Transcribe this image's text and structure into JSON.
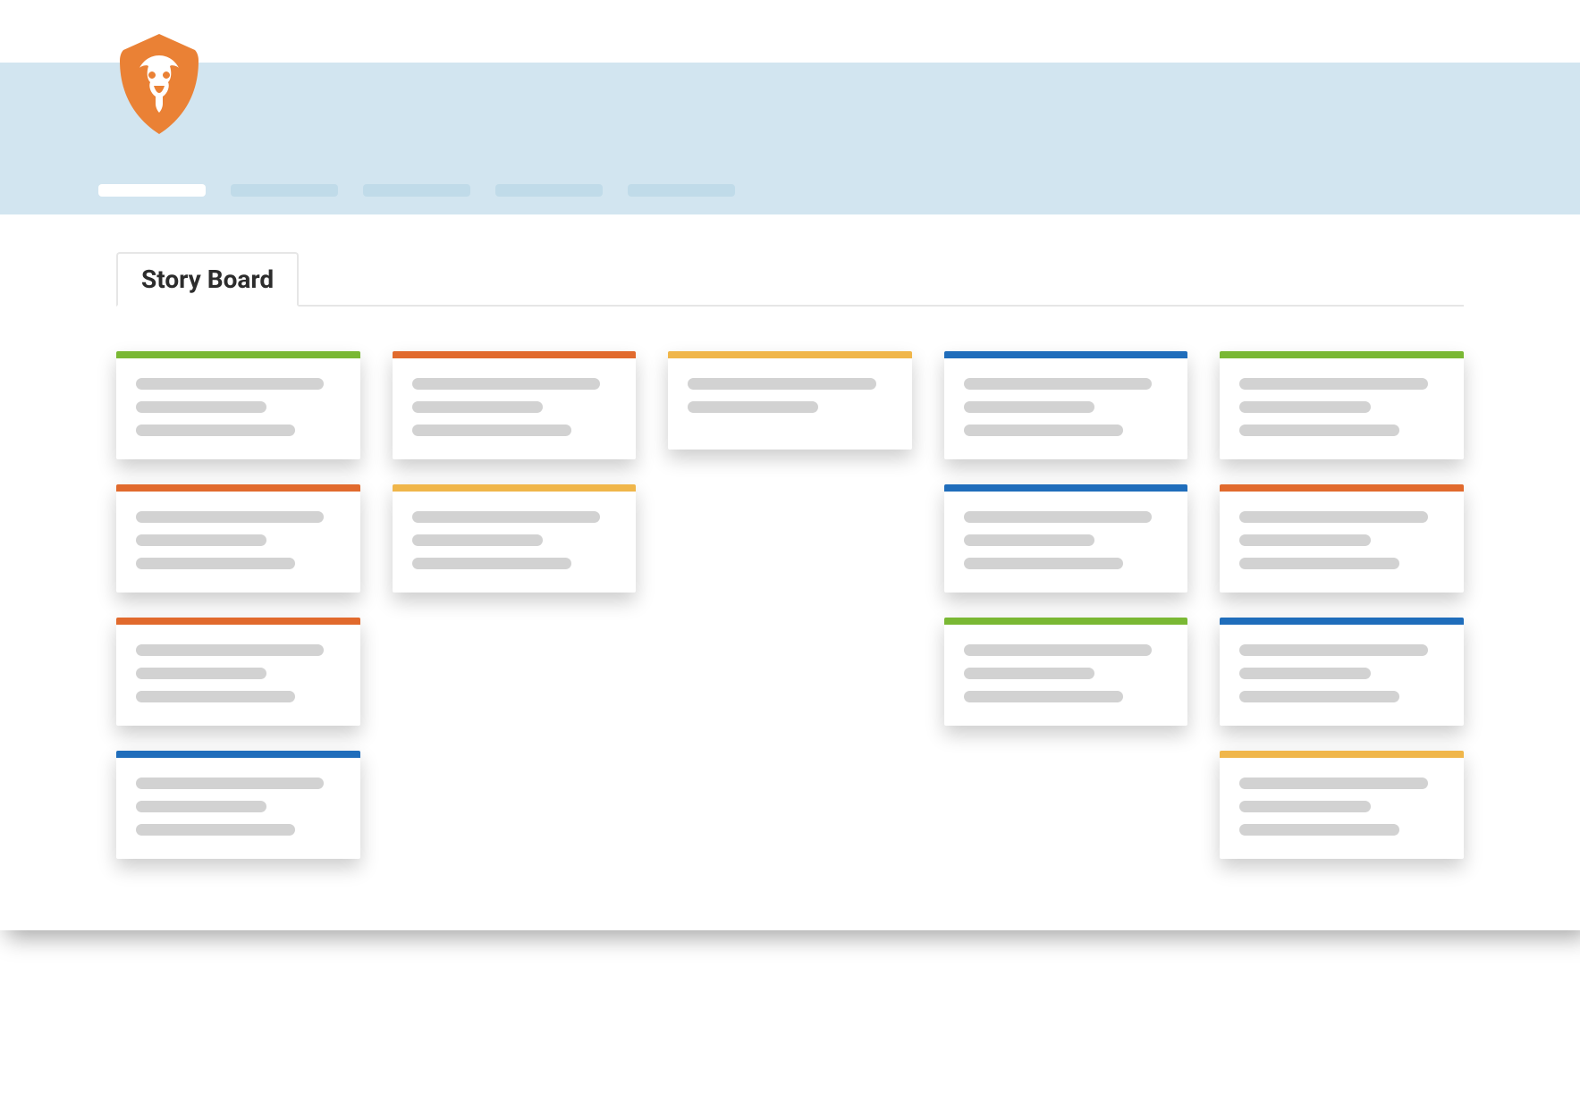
{
  "brand": {
    "logo_color": "#ea8135"
  },
  "header": {
    "band_color": "#d2e5f0",
    "nav_active_index": 0,
    "nav_placeholder_count": 5
  },
  "tabs": {
    "active_label": "Story Board"
  },
  "colors": {
    "green": "#7ab834",
    "orange": "#e16a2d",
    "yellow": "#f0b64a",
    "blue": "#1f6dbb"
  },
  "board": {
    "columns": [
      {
        "cards": [
          {
            "color": "green",
            "lines": 3
          },
          {
            "color": "orange",
            "lines": 3
          },
          {
            "color": "orange",
            "lines": 3
          },
          {
            "color": "blue",
            "lines": 3
          }
        ]
      },
      {
        "cards": [
          {
            "color": "orange",
            "lines": 3
          },
          {
            "color": "yellow",
            "lines": 3
          }
        ]
      },
      {
        "cards": [
          {
            "color": "yellow",
            "lines": 2
          }
        ]
      },
      {
        "cards": [
          {
            "color": "blue",
            "lines": 3
          },
          {
            "color": "blue",
            "lines": 3
          },
          {
            "color": "green",
            "lines": 3
          }
        ]
      },
      {
        "cards": [
          {
            "color": "green",
            "lines": 3
          },
          {
            "color": "orange",
            "lines": 3
          },
          {
            "color": "blue",
            "lines": 3
          },
          {
            "color": "yellow",
            "lines": 3
          }
        ]
      }
    ]
  }
}
